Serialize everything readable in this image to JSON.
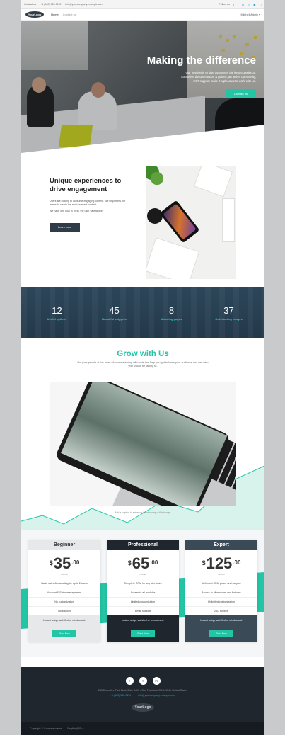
{
  "topbar": {
    "contact": "Contact us",
    "phone": "+1 (900) 555 0112",
    "email": "info@yourcompany.example.com",
    "follow": "Follow us"
  },
  "navbar": {
    "logo": "YourLogo",
    "links": [
      "Home",
      "Contact us"
    ],
    "user": "Mitchell Admin ▾"
  },
  "hero": {
    "title": "Making the difference",
    "lines": [
      "Our mission is to give customers the best experience.",
      "Extensive documentation & guides, an active community,",
      "24/7 support make it a pleasure to work with us."
    ],
    "cta": "Contact us"
  },
  "unique": {
    "title": "Unique experiences to drive engagement",
    "p1": "Users are looking to consume engaging content. We empowers our teams to create the most relevant content.",
    "p2": "We have one goal in mind, the user satisfaction.",
    "cta": "Learn more"
  },
  "stats": [
    {
      "num": "12",
      "label": "Useful options"
    },
    {
      "num": "45",
      "label": "Beautiful snippets"
    },
    {
      "num": "8",
      "label": "Amazing pages"
    },
    {
      "num": "37",
      "label": "Outstanding images"
    }
  ],
  "grow": {
    "title": "Grow with Us",
    "sub": "Put your people at the heart of your marketing with tools that help you get to know your audience and see who you should be talking to.",
    "caption": "Add a caption to enhance the meaning of this image."
  },
  "plans": [
    {
      "name": "Beginner",
      "cur": "$",
      "amt": "35",
      "cents": ".00",
      "per": "/ month",
      "features": [
        "Basic sales & marketing for up to 2 users",
        "Account & Sales management",
        "No customization",
        "No support"
      ],
      "note": "Instant setup, satisfied or reimbursed.",
      "cta": "Start Now"
    },
    {
      "name": "Professional",
      "cur": "$",
      "amt": "65",
      "cents": ".00",
      "per": "/ month",
      "features": [
        "Complete CRM for any size team",
        "Access to all modules",
        "Limited customization",
        "Email support"
      ],
      "note": "Instant setup, satisfied or reimbursed.",
      "cta": "Start Now"
    },
    {
      "name": "Expert",
      "cur": "$",
      "amt": "125",
      "cents": ".00",
      "per": "/ month",
      "features": [
        "Unlimited CRM power and support",
        "Access to all modules and features",
        "Unlimited customization",
        "24/7 support"
      ],
      "note": "Instant setup, satisfied or reimbursed.",
      "cta": "Start Now"
    }
  ],
  "footer": {
    "social": [
      "f",
      "t",
      "in"
    ],
    "address": "250 Executive Park Blvd, Suite 3400 • San Francisco CA 94134 • United States",
    "phone": "+1 (650) 555-0111",
    "email": "info@yourcompany.example.com",
    "logo": "YourLogo"
  },
  "copyright": {
    "text": "Copyright © Company name",
    "lang": "English (US) ▾"
  },
  "colors": {
    "accent": "#23c5a5",
    "dark": "#1f262d",
    "stats_bg": "#2c4659"
  }
}
